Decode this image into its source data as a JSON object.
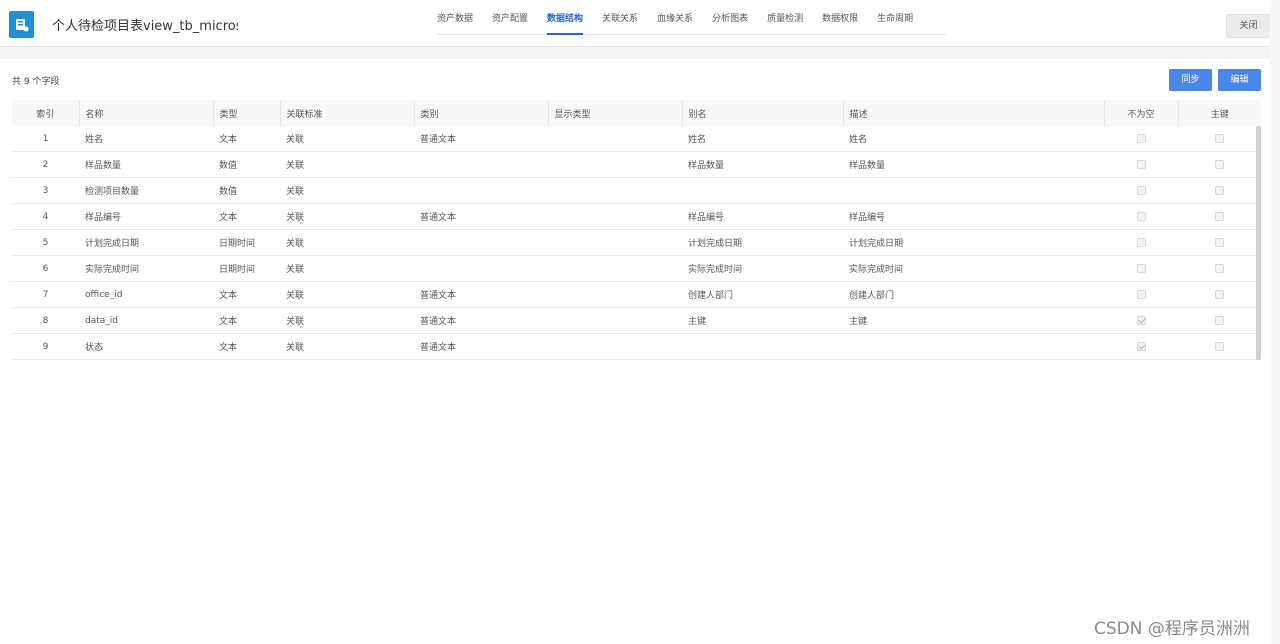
{
  "header": {
    "logo_icon": "database-book-icon",
    "title": "个人待检项目表view_tb_microstruc",
    "tabs": [
      "资产数据",
      "资产配置",
      "数据结构",
      "关联关系",
      "血缘关系",
      "分析图表",
      "质量检测",
      "数据权限",
      "生命周期"
    ],
    "active_tab": "数据结构",
    "close_label": "关闭"
  },
  "toolbar": {
    "count_text": "共 9 个字段",
    "sync_label": "同步",
    "edit_label": "编辑"
  },
  "table": {
    "columns": [
      "索引",
      "名称",
      "类型",
      "关联标准",
      "类别",
      "显示类型",
      "别名",
      "描述",
      "不为空",
      "主键"
    ],
    "rows": [
      {
        "index": "1",
        "name": "姓名",
        "type": "文本",
        "standard": "关联",
        "category": "普通文本",
        "display": "",
        "alias": "姓名",
        "desc": "姓名",
        "not_null": false,
        "pk": false
      },
      {
        "index": "2",
        "name": "样品数量",
        "type": "数值",
        "standard": "关联",
        "category": "",
        "display": "",
        "alias": "样品数量",
        "desc": "样品数量",
        "not_null": false,
        "pk": false
      },
      {
        "index": "3",
        "name": "检测项目数量",
        "type": "数值",
        "standard": "关联",
        "category": "",
        "display": "",
        "alias": "",
        "desc": "",
        "not_null": false,
        "pk": false
      },
      {
        "index": "4",
        "name": "样品编号",
        "type": "文本",
        "standard": "关联",
        "category": "普通文本",
        "display": "",
        "alias": "样品编号",
        "desc": "样品编号",
        "not_null": false,
        "pk": false
      },
      {
        "index": "5",
        "name": "计划完成日期",
        "type": "日期时间",
        "standard": "关联",
        "category": "",
        "display": "",
        "alias": "计划完成日期",
        "desc": "计划完成日期",
        "not_null": false,
        "pk": false
      },
      {
        "index": "6",
        "name": "实际完成时间",
        "type": "日期时间",
        "standard": "关联",
        "category": "",
        "display": "",
        "alias": "实际完成时间",
        "desc": "实际完成时间",
        "not_null": false,
        "pk": false
      },
      {
        "index": "7",
        "name": "office_id",
        "type": "文本",
        "standard": "关联",
        "category": "普通文本",
        "display": "",
        "alias": "创建人部门",
        "desc": "创建人部门",
        "not_null": false,
        "pk": false
      },
      {
        "index": "8",
        "name": "data_id",
        "type": "文本",
        "standard": "关联",
        "category": "普通文本",
        "display": "",
        "alias": "主键",
        "desc": "主键",
        "not_null": true,
        "pk": false
      },
      {
        "index": "9",
        "name": "状态",
        "type": "文本",
        "standard": "关联",
        "category": "普通文本",
        "display": "",
        "alias": "",
        "desc": "",
        "not_null": true,
        "pk": false
      }
    ]
  },
  "watermark": "CSDN @程序员洲洲",
  "colors": {
    "accent": "#2b63d9",
    "button": "#4a86e8",
    "logo": "#1e8fd8"
  }
}
